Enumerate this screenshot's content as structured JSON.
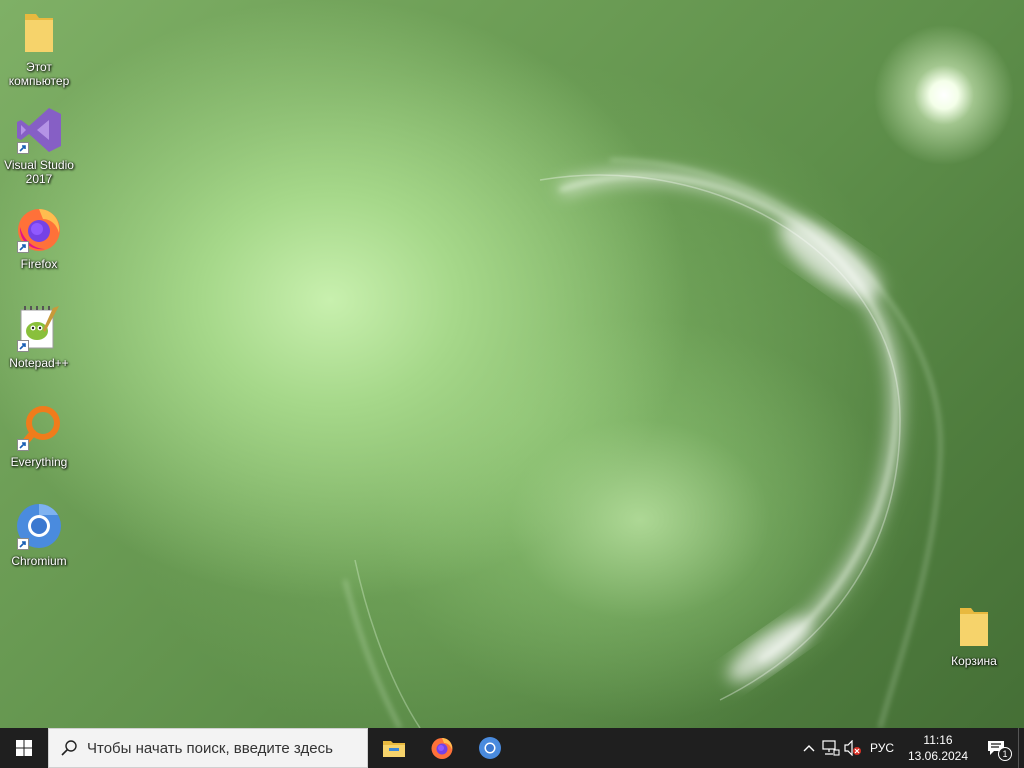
{
  "desktop": {
    "icons": [
      {
        "label": "Этот\nкомпьютер",
        "icon": "folder-icon"
      },
      {
        "label": "Visual Studio\n2017",
        "icon": "visual-studio-icon"
      },
      {
        "label": "Firefox",
        "icon": "firefox-icon"
      },
      {
        "label": "Notepad++",
        "icon": "notepad-plus-plus-icon"
      },
      {
        "label": "Everything",
        "icon": "everything-search-icon"
      },
      {
        "label": "Chromium",
        "icon": "chromium-icon"
      }
    ],
    "recycle_bin": {
      "label": "Корзина",
      "icon": "folder-icon"
    }
  },
  "taskbar": {
    "search_placeholder": "Чтобы начать поиск, введите здесь",
    "pinned": [
      {
        "icon": "file-explorer-icon"
      },
      {
        "icon": "firefox-icon"
      },
      {
        "icon": "chromium-icon"
      }
    ],
    "tray": {
      "language": "РУС",
      "time": "11:16",
      "date": "13.06.2024",
      "notification_count": "1"
    }
  },
  "colors": {
    "taskbar": "#1f1f1f",
    "search_box": "#f3f3f3",
    "folder": "#f0c34b",
    "visual_studio": "#865fc5",
    "everything": "#f07c1b",
    "chromium": "#4a8bde"
  }
}
